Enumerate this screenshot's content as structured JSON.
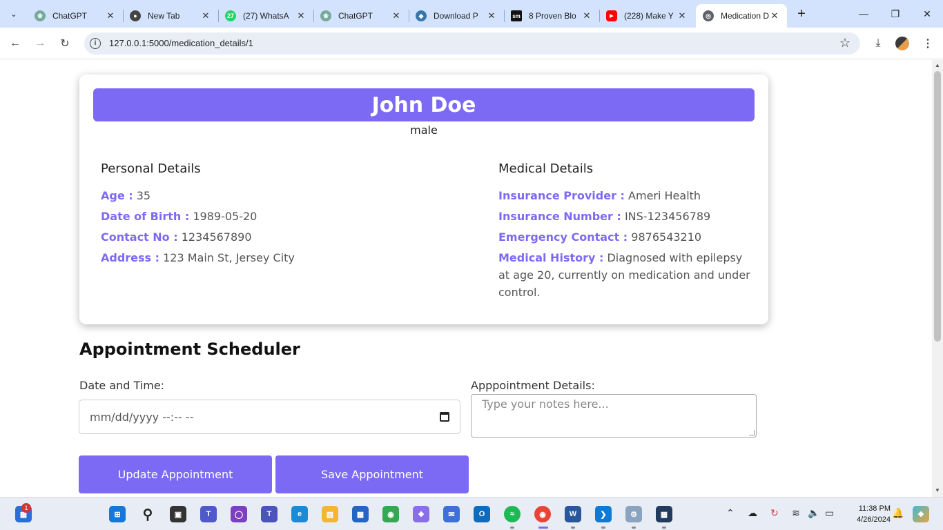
{
  "browser": {
    "tabs": [
      {
        "title": "ChatGPT",
        "favicon": "chatgpt-icon",
        "color": "#74aa9c"
      },
      {
        "title": "New Tab",
        "favicon": "chrome-icon",
        "color": "#444444"
      },
      {
        "title": "(27) WhatsA",
        "favicon": "whatsapp-icon",
        "color": "#25d366",
        "badge": "27"
      },
      {
        "title": "ChatGPT",
        "favicon": "chatgpt-icon",
        "color": "#74aa9c"
      },
      {
        "title": "Download P",
        "favicon": "python-icon",
        "color": "#3776ab"
      },
      {
        "title": "8 Proven Blo",
        "favicon": "sm-icon",
        "color": "#111111",
        "badge": "sm"
      },
      {
        "title": "(228) Make Y",
        "favicon": "youtube-icon",
        "color": "#ff0000"
      },
      {
        "title": "Medication D",
        "favicon": "globe-icon",
        "color": "#5f6368"
      }
    ],
    "url": "127.0.0.1:5000/medication_details/1"
  },
  "patient": {
    "name": "John Doe",
    "gender": "male",
    "personal_heading": "Personal Details",
    "medical_heading": "Medical Details",
    "personal": [
      {
        "label": "Age :",
        "value": "35"
      },
      {
        "label": "Date of Birth :",
        "value": "1989-05-20"
      },
      {
        "label": "Contact No :",
        "value": "1234567890"
      },
      {
        "label": "Address :",
        "value": "123 Main St, Jersey City"
      }
    ],
    "medical": [
      {
        "label": "Insurance Provider :",
        "value": "Ameri Health"
      },
      {
        "label": "Insurance Number :",
        "value": "INS-123456789"
      },
      {
        "label": "Emergency Contact :",
        "value": "9876543210"
      },
      {
        "label": "Medical History :",
        "value": "Diagnosed with epilepsy at age 20, currently on medication and under control."
      }
    ]
  },
  "scheduler": {
    "title": "Appointment Scheduler",
    "date_label": "Date and Time:",
    "date_placeholder": "mm/dd/yyyy --:-- --",
    "details_label": "Apppointment Details:",
    "details_placeholder": "Type your notes here...",
    "update_button": "Update Appointment",
    "save_button": "Save Appointment"
  },
  "colors": {
    "accent": "#7d6af4"
  },
  "taskbar": {
    "start_badge": "1",
    "time": "11:38 PM",
    "date": "4/26/2024"
  }
}
